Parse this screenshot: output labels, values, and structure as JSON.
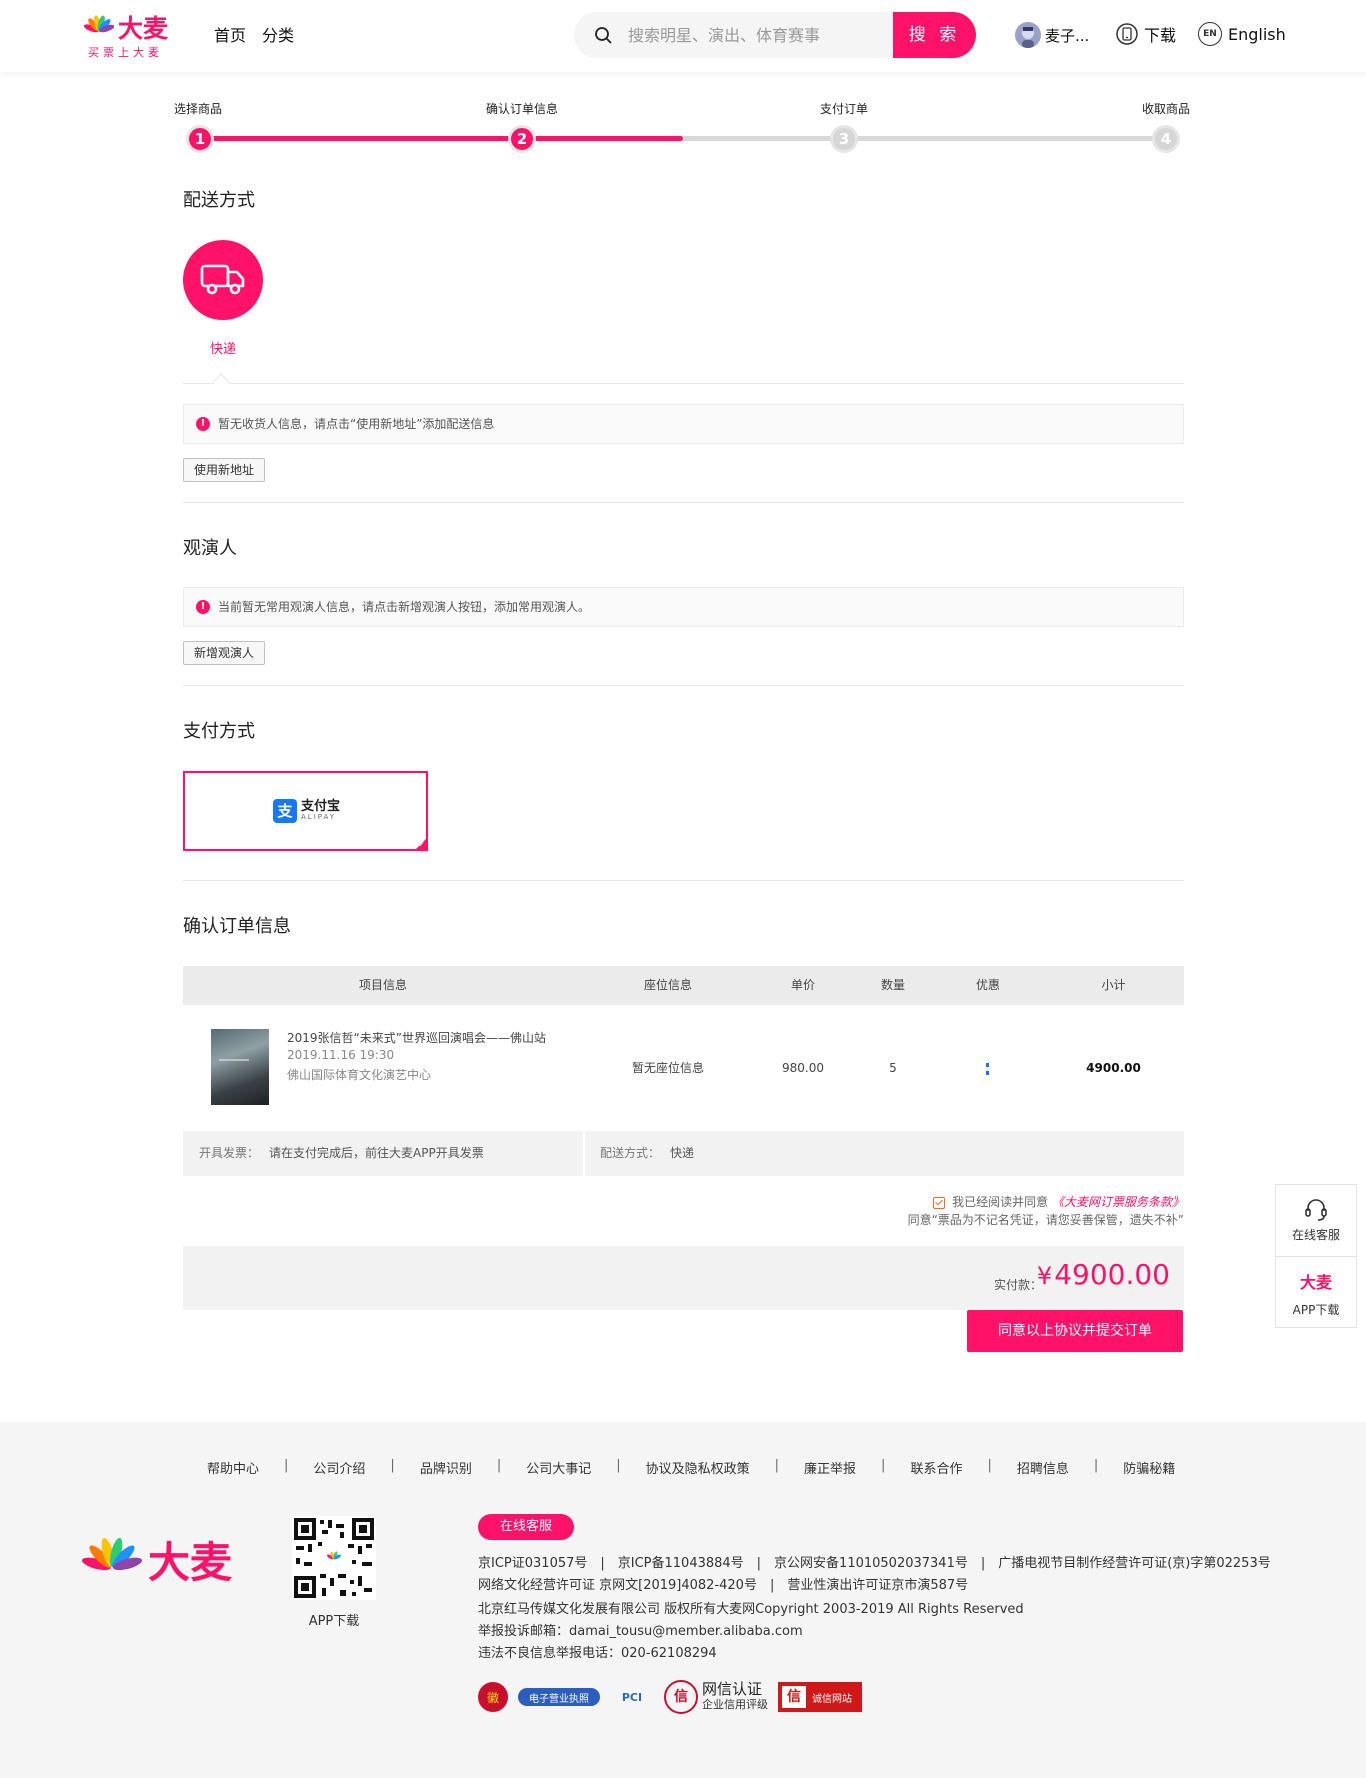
{
  "header": {
    "logo_text": "大麦",
    "logo_slogan": "买票上大麦",
    "nav": [
      "首页",
      "分类"
    ],
    "search_placeholder": "搜索明星、演出、体育赛事",
    "search_button": "搜 索",
    "username": "麦子...",
    "download": "下载",
    "lang_badge": "EN",
    "language": "English"
  },
  "steps": [
    {
      "label": "选择商品",
      "num": "1",
      "state": "done"
    },
    {
      "label": "确认订单信息",
      "num": "2",
      "state": "current"
    },
    {
      "label": "支付订单",
      "num": "3",
      "state": "pending"
    },
    {
      "label": "收取商品",
      "num": "4",
      "state": "pending"
    }
  ],
  "progress": 0.5,
  "delivery": {
    "title": "配送方式",
    "option": "快递",
    "icon": "truck-icon",
    "notice": "暂无收货人信息，请点击“使用新地址”添加配送信息",
    "button": "使用新地址"
  },
  "viewers": {
    "title": "观演人",
    "notice": "当前暂无常用观演人信息，请点击新增观演人按钮，添加常用观演人。",
    "button": "新增观演人"
  },
  "payment": {
    "title": "支付方式",
    "brand_mark": "支",
    "brand_name": "支付宝",
    "brand_sub": "ALIPAY"
  },
  "order": {
    "title": "确认订单信息",
    "columns": [
      "项目信息",
      "座位信息",
      "单价",
      "数量",
      "优惠",
      "小计"
    ],
    "item": {
      "title": "2019张信哲“未来式”世界巡回演唱会——佛山站",
      "date": "2019.11.16 19:30",
      "venue": "佛山国际体育文化演艺中心",
      "seat": "暂无座位信息",
      "price": "980.00",
      "quantity": "5",
      "subtotal": "4900.00"
    },
    "invoice_label": "开具发票：",
    "invoice_value": "请在支付完成后，前往大麦APP开具发票",
    "shipping_label": "配送方式：",
    "shipping_value": "快递"
  },
  "agreement": {
    "prefix": "我已经阅读并同意",
    "link": "《大麦网订票服务条款》",
    "note": "同意“票品为不记名凭证，请您妥善保管，遗失不补”"
  },
  "total": {
    "label": "实付款：",
    "currency": "¥",
    "amount": "4900.00"
  },
  "submit_button": "同意以上协议并提交订单",
  "float": {
    "service": "在线客服",
    "brand": "大麦",
    "app": "APP下载"
  },
  "footer": {
    "links": [
      "帮助中心",
      "公司介绍",
      "品牌识别",
      "公司大事记",
      "协议及隐私权政策",
      "廉正举报",
      "联系合作",
      "招聘信息",
      "防骗秘籍"
    ],
    "logo_text": "大麦",
    "qr_label": "APP下载",
    "service_button": "在线客服",
    "lines": [
      "京ICP证031057号　|　京ICP备11043884号　|　京公网安备11010502037341号　|　广播电视节目制作经营许可证(京)字第02253号",
      "网络文化经营许可证 京网文[2019]4082-420号　|　营业性演出许可证京市演587号",
      "北京红马传媒文化发展有限公司 版权所有大麦网Copyright 2003-2019 All Rights Reserved",
      "举报投诉邮箱：damai_tousu@member.alibaba.com",
      "违法不良信息举报电话：020-62108294"
    ],
    "badges": {
      "b1": "徽",
      "b2": "电子营业执照",
      "b3": "PCI",
      "b4_mark": "信",
      "b4_title": "网信认证",
      "b4_sub": "企业信用评级",
      "b5_mark": "信",
      "b5_text": "诚信网站"
    }
  },
  "colors": {
    "brand": "#ff1268",
    "alipay": "#1677ff"
  }
}
